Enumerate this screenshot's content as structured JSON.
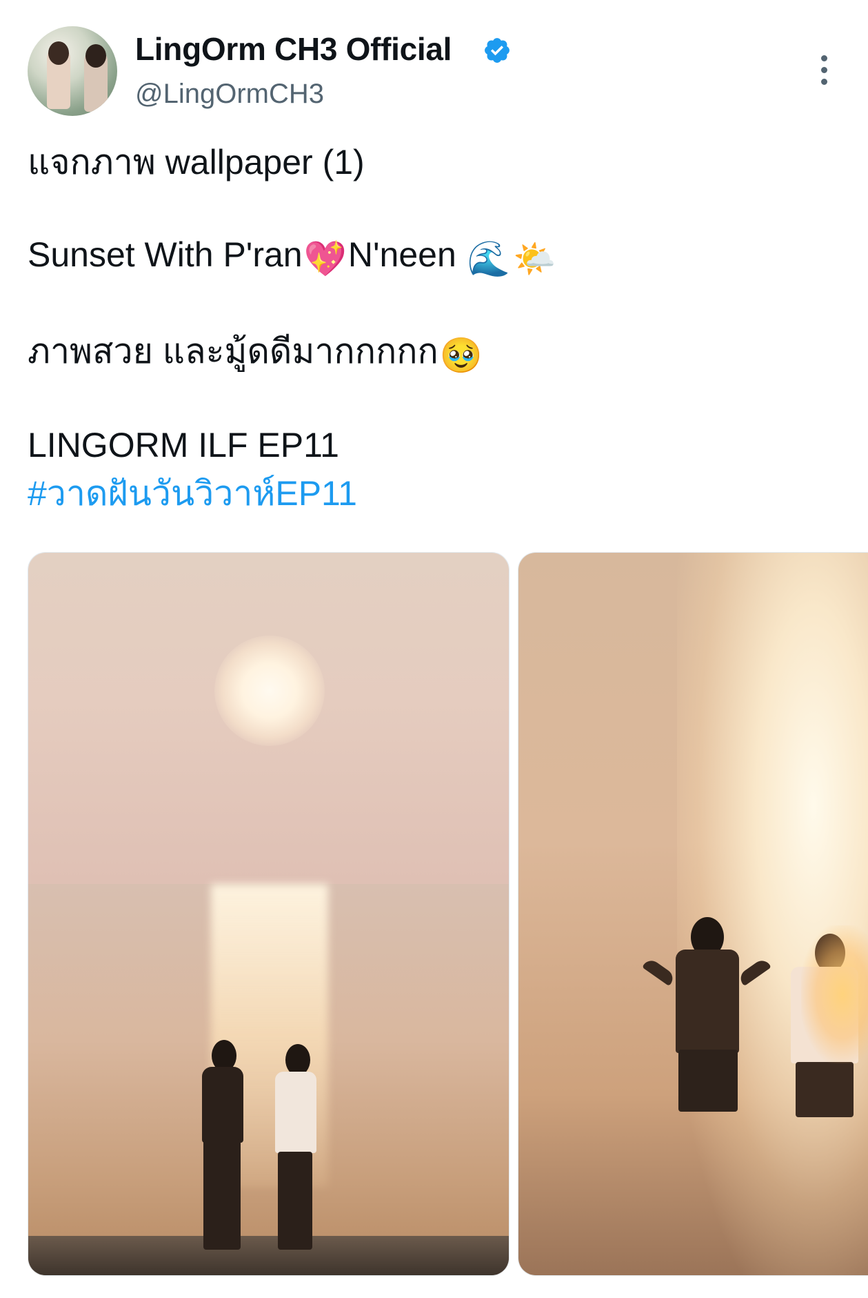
{
  "author": {
    "display_name": "LingOrm CH3 Official",
    "handle": "@LingOrmCH3",
    "verified": true
  },
  "tweet": {
    "line1": "แจกภาพ wallpaper (1)",
    "line2_prefix": "Sunset With P'ran",
    "line2_emoji_heart": "💖",
    "line2_suffix": "N'neen",
    "line2_emoji_wave": "🌊",
    "line2_emoji_cloud": "🌤️",
    "line3_text": "ภาพสวย และมู้ดดีมากกกกก",
    "line3_emoji": "🥹",
    "line4": "LINGORM ILF EP11",
    "hashtag": "#วาดฝันวันวิวาห์EP11"
  },
  "media": {
    "count": 2
  },
  "colors": {
    "text": "#0f1419",
    "secondary_text": "#536471",
    "link": "#1d9bf0",
    "verified": "#1d9bf0"
  },
  "icons": {
    "verified": "verified-badge-icon",
    "more": "more-vertical-icon"
  }
}
